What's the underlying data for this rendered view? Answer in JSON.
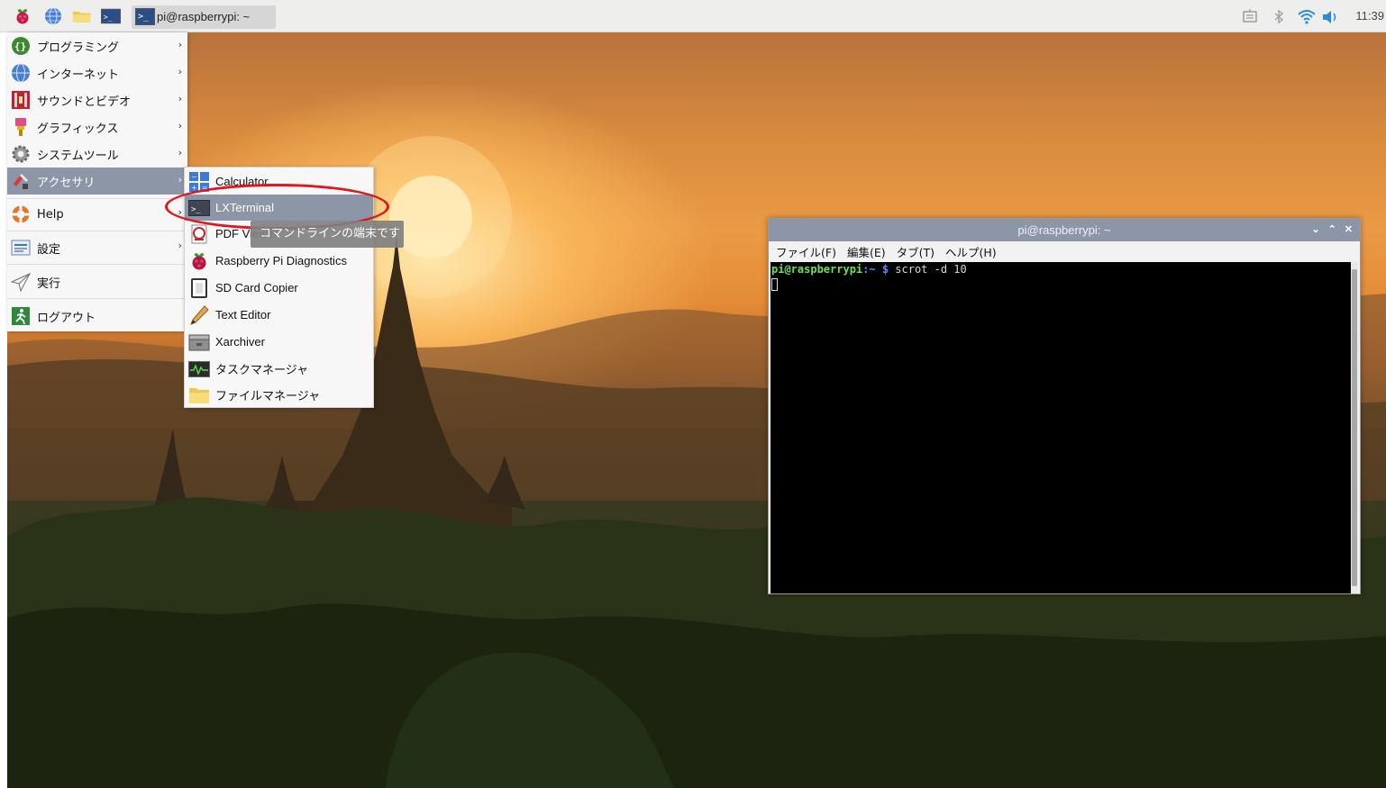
{
  "panel": {
    "task_button_label": "pi@raspberrypi: ~",
    "clock": "11:39"
  },
  "menu": {
    "items": [
      {
        "label": "プログラミング",
        "icon": "programming-icon",
        "has_submenu": true
      },
      {
        "label": "インターネット",
        "icon": "globe-icon",
        "has_submenu": true
      },
      {
        "label": "サウンドとビデオ",
        "icon": "sound-video-icon",
        "has_submenu": true
      },
      {
        "label": "グラフィックス",
        "icon": "paintbrush-icon",
        "has_submenu": true
      },
      {
        "label": "システムツール",
        "icon": "gear-icon",
        "has_submenu": true
      },
      {
        "label": "アクセサリ",
        "icon": "accessories-icon",
        "has_submenu": true,
        "active": true
      },
      {
        "label": "Help",
        "icon": "lifebuoy-icon",
        "has_submenu": true
      },
      {
        "label": "設定",
        "icon": "settings-panel-icon",
        "has_submenu": true
      },
      {
        "label": "実行",
        "icon": "paper-plane-icon",
        "has_submenu": false
      },
      {
        "label": "ログアウト",
        "icon": "logout-icon",
        "has_submenu": false
      }
    ]
  },
  "submenu": {
    "items": [
      {
        "label": "Calculator",
        "icon": "calculator-icon"
      },
      {
        "label": "LXTerminal",
        "icon": "terminal-icon",
        "active": true
      },
      {
        "label": "PDF Viewer",
        "icon": "pdf-viewer-icon"
      },
      {
        "label": "Raspberry Pi Diagnostics",
        "icon": "raspberry-icon"
      },
      {
        "label": "SD Card Copier",
        "icon": "sd-card-icon"
      },
      {
        "label": "Text Editor",
        "icon": "pencil-icon"
      },
      {
        "label": "Xarchiver",
        "icon": "archive-icon"
      },
      {
        "label": "タスクマネージャ",
        "icon": "task-manager-icon"
      },
      {
        "label": "ファイルマネージャ",
        "icon": "folder-icon"
      }
    ]
  },
  "tooltip": "コマンドラインの端末です",
  "terminal": {
    "title": "pi@raspberrypi: ~",
    "controls": {
      "minimize": "⌄",
      "maximize": "⌃",
      "close": "✕"
    },
    "menubar": [
      "ファイル(F)",
      "編集(E)",
      "タブ(T)",
      "ヘルプ(H)"
    ],
    "prompt_user": "pi@raspberrypi",
    "prompt_path": ":~ $ ",
    "command": "scrot -d 10"
  },
  "colors": {
    "panel_bg": "#eeeeec",
    "menu_highlight": "#8c96a7",
    "annotation_ring": "#e0151d",
    "terminal_prompt_user": "#6fe04a",
    "terminal_prompt_path": "#5c8cff"
  }
}
